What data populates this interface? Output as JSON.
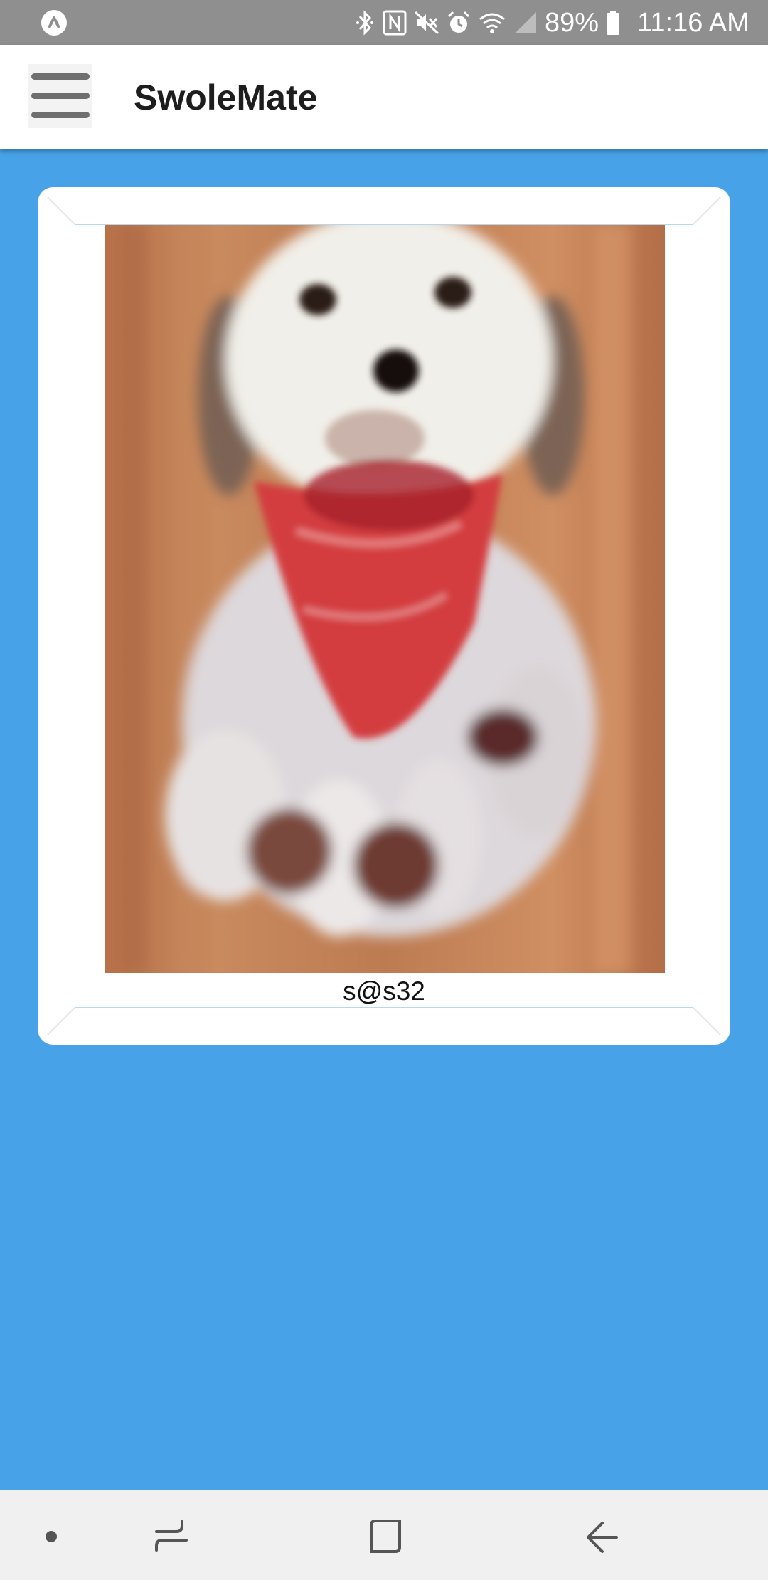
{
  "status_bar": {
    "battery_percent": "89%",
    "time": "11:16 AM",
    "icons": [
      "app-notification-icon",
      "bluetooth-icon",
      "nfc-icon",
      "mute-icon",
      "alarm-icon",
      "wifi-icon",
      "signal-icon",
      "battery-icon"
    ]
  },
  "app_bar": {
    "title": "SwoleMate",
    "menu_icon": "hamburger-menu-icon"
  },
  "profile_card": {
    "photo_subject": "white puppy with red bandana",
    "username": "s@s32"
  },
  "nav_bar": {
    "icons": [
      "dot-icon",
      "recent-apps-icon",
      "home-icon",
      "back-icon"
    ]
  },
  "colors": {
    "background": "#47a2e7",
    "status_bar": "#8f8f8f",
    "app_bar": "#ffffff",
    "card": "#ffffff",
    "nav_bar": "#f0f0f0"
  }
}
